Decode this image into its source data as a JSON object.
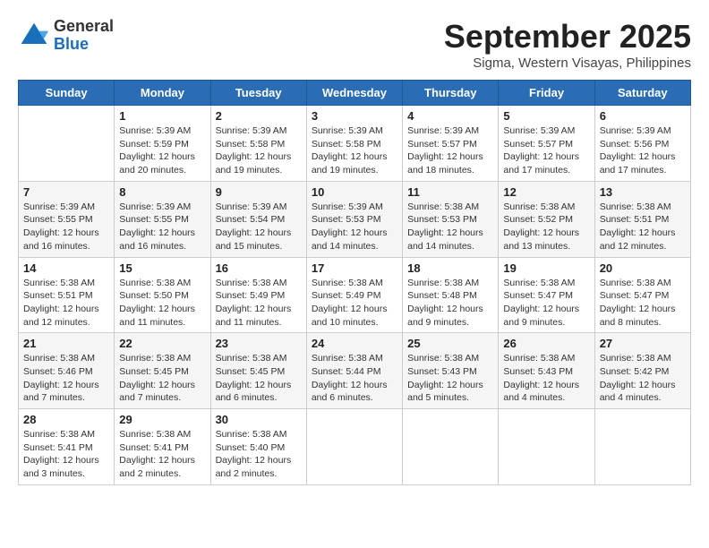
{
  "header": {
    "logo_general": "General",
    "logo_blue": "Blue",
    "title": "September 2025",
    "subtitle": "Sigma, Western Visayas, Philippines"
  },
  "weekdays": [
    "Sunday",
    "Monday",
    "Tuesday",
    "Wednesday",
    "Thursday",
    "Friday",
    "Saturday"
  ],
  "weeks": [
    [
      {
        "date": "",
        "info": ""
      },
      {
        "date": "1",
        "info": "Sunrise: 5:39 AM\nSunset: 5:59 PM\nDaylight: 12 hours\nand 20 minutes."
      },
      {
        "date": "2",
        "info": "Sunrise: 5:39 AM\nSunset: 5:58 PM\nDaylight: 12 hours\nand 19 minutes."
      },
      {
        "date": "3",
        "info": "Sunrise: 5:39 AM\nSunset: 5:58 PM\nDaylight: 12 hours\nand 19 minutes."
      },
      {
        "date": "4",
        "info": "Sunrise: 5:39 AM\nSunset: 5:57 PM\nDaylight: 12 hours\nand 18 minutes."
      },
      {
        "date": "5",
        "info": "Sunrise: 5:39 AM\nSunset: 5:57 PM\nDaylight: 12 hours\nand 17 minutes."
      },
      {
        "date": "6",
        "info": "Sunrise: 5:39 AM\nSunset: 5:56 PM\nDaylight: 12 hours\nand 17 minutes."
      }
    ],
    [
      {
        "date": "7",
        "info": "Sunrise: 5:39 AM\nSunset: 5:55 PM\nDaylight: 12 hours\nand 16 minutes."
      },
      {
        "date": "8",
        "info": "Sunrise: 5:39 AM\nSunset: 5:55 PM\nDaylight: 12 hours\nand 16 minutes."
      },
      {
        "date": "9",
        "info": "Sunrise: 5:39 AM\nSunset: 5:54 PM\nDaylight: 12 hours\nand 15 minutes."
      },
      {
        "date": "10",
        "info": "Sunrise: 5:39 AM\nSunset: 5:53 PM\nDaylight: 12 hours\nand 14 minutes."
      },
      {
        "date": "11",
        "info": "Sunrise: 5:38 AM\nSunset: 5:53 PM\nDaylight: 12 hours\nand 14 minutes."
      },
      {
        "date": "12",
        "info": "Sunrise: 5:38 AM\nSunset: 5:52 PM\nDaylight: 12 hours\nand 13 minutes."
      },
      {
        "date": "13",
        "info": "Sunrise: 5:38 AM\nSunset: 5:51 PM\nDaylight: 12 hours\nand 12 minutes."
      }
    ],
    [
      {
        "date": "14",
        "info": "Sunrise: 5:38 AM\nSunset: 5:51 PM\nDaylight: 12 hours\nand 12 minutes."
      },
      {
        "date": "15",
        "info": "Sunrise: 5:38 AM\nSunset: 5:50 PM\nDaylight: 12 hours\nand 11 minutes."
      },
      {
        "date": "16",
        "info": "Sunrise: 5:38 AM\nSunset: 5:49 PM\nDaylight: 12 hours\nand 11 minutes."
      },
      {
        "date": "17",
        "info": "Sunrise: 5:38 AM\nSunset: 5:49 PM\nDaylight: 12 hours\nand 10 minutes."
      },
      {
        "date": "18",
        "info": "Sunrise: 5:38 AM\nSunset: 5:48 PM\nDaylight: 12 hours\nand 9 minutes."
      },
      {
        "date": "19",
        "info": "Sunrise: 5:38 AM\nSunset: 5:47 PM\nDaylight: 12 hours\nand 9 minutes."
      },
      {
        "date": "20",
        "info": "Sunrise: 5:38 AM\nSunset: 5:47 PM\nDaylight: 12 hours\nand 8 minutes."
      }
    ],
    [
      {
        "date": "21",
        "info": "Sunrise: 5:38 AM\nSunset: 5:46 PM\nDaylight: 12 hours\nand 7 minutes."
      },
      {
        "date": "22",
        "info": "Sunrise: 5:38 AM\nSunset: 5:45 PM\nDaylight: 12 hours\nand 7 minutes."
      },
      {
        "date": "23",
        "info": "Sunrise: 5:38 AM\nSunset: 5:45 PM\nDaylight: 12 hours\nand 6 minutes."
      },
      {
        "date": "24",
        "info": "Sunrise: 5:38 AM\nSunset: 5:44 PM\nDaylight: 12 hours\nand 6 minutes."
      },
      {
        "date": "25",
        "info": "Sunrise: 5:38 AM\nSunset: 5:43 PM\nDaylight: 12 hours\nand 5 minutes."
      },
      {
        "date": "26",
        "info": "Sunrise: 5:38 AM\nSunset: 5:43 PM\nDaylight: 12 hours\nand 4 minutes."
      },
      {
        "date": "27",
        "info": "Sunrise: 5:38 AM\nSunset: 5:42 PM\nDaylight: 12 hours\nand 4 minutes."
      }
    ],
    [
      {
        "date": "28",
        "info": "Sunrise: 5:38 AM\nSunset: 5:41 PM\nDaylight: 12 hours\nand 3 minutes."
      },
      {
        "date": "29",
        "info": "Sunrise: 5:38 AM\nSunset: 5:41 PM\nDaylight: 12 hours\nand 2 minutes."
      },
      {
        "date": "30",
        "info": "Sunrise: 5:38 AM\nSunset: 5:40 PM\nDaylight: 12 hours\nand 2 minutes."
      },
      {
        "date": "",
        "info": ""
      },
      {
        "date": "",
        "info": ""
      },
      {
        "date": "",
        "info": ""
      },
      {
        "date": "",
        "info": ""
      }
    ]
  ]
}
